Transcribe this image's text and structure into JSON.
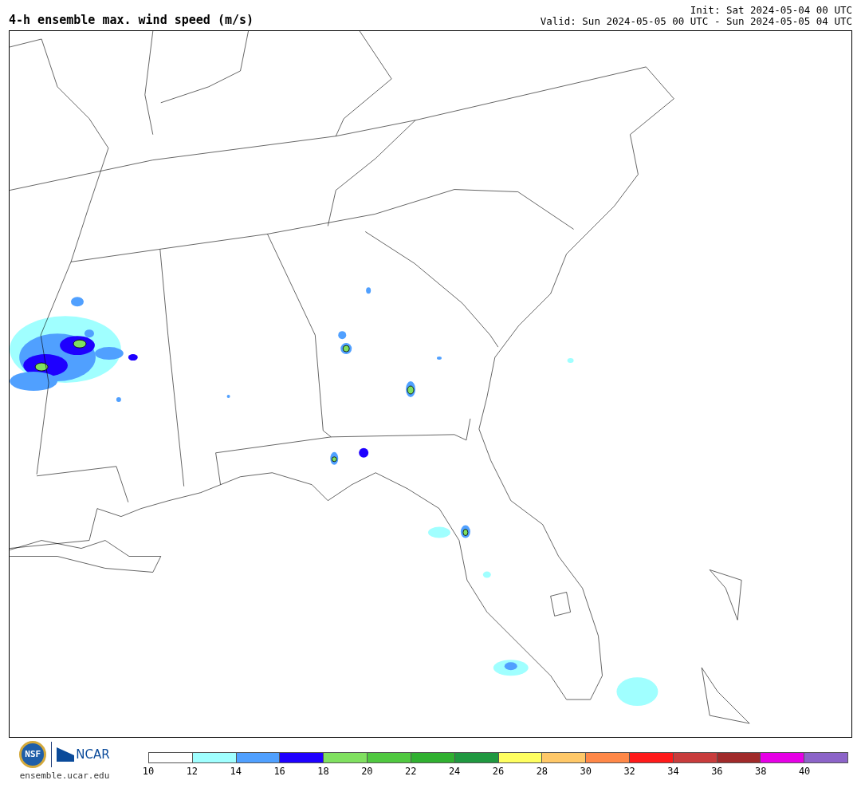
{
  "title": "4-h ensemble max. wind speed (m/s)",
  "init": "Init: Sat 2024-05-04 00 UTC",
  "valid": "Valid: Sun 2024-05-05 00 UTC - Sun 2024-05-05 04 UTC",
  "logos": {
    "nsf": "NSF",
    "ncar": "NCAR"
  },
  "site": "ensemble.ucar.edu",
  "colorbar": [
    {
      "label": "10",
      "color": "#ffffff"
    },
    {
      "label": "12",
      "color": "#a0ffff"
    },
    {
      "label": "14",
      "color": "#50a0ff"
    },
    {
      "label": "16",
      "color": "#1e00ff"
    },
    {
      "label": "18",
      "color": "#80e060"
    },
    {
      "label": "20",
      "color": "#50c840"
    },
    {
      "label": "22",
      "color": "#30b030"
    },
    {
      "label": "24",
      "color": "#209840"
    },
    {
      "label": "26",
      "color": "#ffff60"
    },
    {
      "label": "28",
      "color": "#ffc868"
    },
    {
      "label": "30",
      "color": "#ff8848"
    },
    {
      "label": "32",
      "color": "#ff1a1a"
    },
    {
      "label": "34",
      "color": "#c83c3c"
    },
    {
      "label": "36",
      "color": "#a02a2a"
    },
    {
      "label": "38",
      "color": "#e600e6"
    },
    {
      "label": "40",
      "color": "#8c64c8"
    }
  ]
}
